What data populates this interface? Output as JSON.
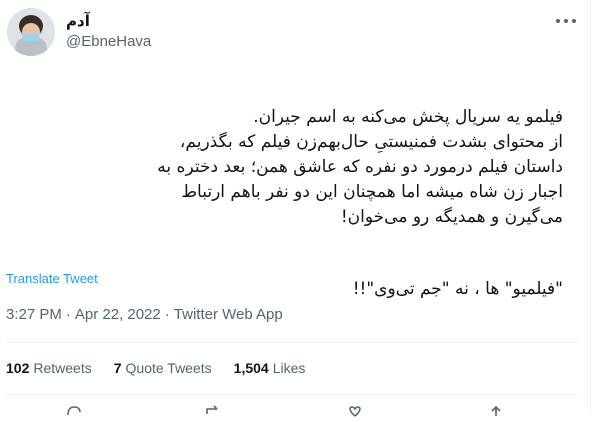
{
  "author": {
    "name": "آدم",
    "handle": "@EbneHava"
  },
  "tweet": {
    "paragraph1": "فیلمو یه سریال پخش می‌کنه به اسم جیران.\nاز محتوای بشدت فمنیستیِ حال‌بهم‌زن فیلم که بگذریم،\nداستان فیلم درمورد دو نفره که عاشق همن؛ بعد دختره به\nاجبار زن شاه میشه اما همچنان این دو نفر باهم ارتباط\nمی‌گیرن و همدیگه رو می‌خوان!",
    "paragraph2": "\"فیلمیو\" ها ، نه \"جم تی‌وی\"!!"
  },
  "translate_label": "Translate Tweet",
  "meta": {
    "time": "3:27 PM",
    "date": "Apr 22, 2022",
    "source": "Twitter Web App",
    "separator": "·"
  },
  "stats": {
    "retweets_count": "102",
    "retweets_label": "Retweets",
    "quotes_count": "7",
    "quotes_label": "Quote Tweets",
    "likes_count": "1,504",
    "likes_label": "Likes"
  },
  "icons": {
    "more": "more-icon",
    "reply": "reply-icon",
    "retweet": "retweet-icon",
    "like": "like-icon",
    "share": "share-icon"
  },
  "colors": {
    "link": "#1d9bf0",
    "secondary": "#536471",
    "text": "#0f1419"
  }
}
